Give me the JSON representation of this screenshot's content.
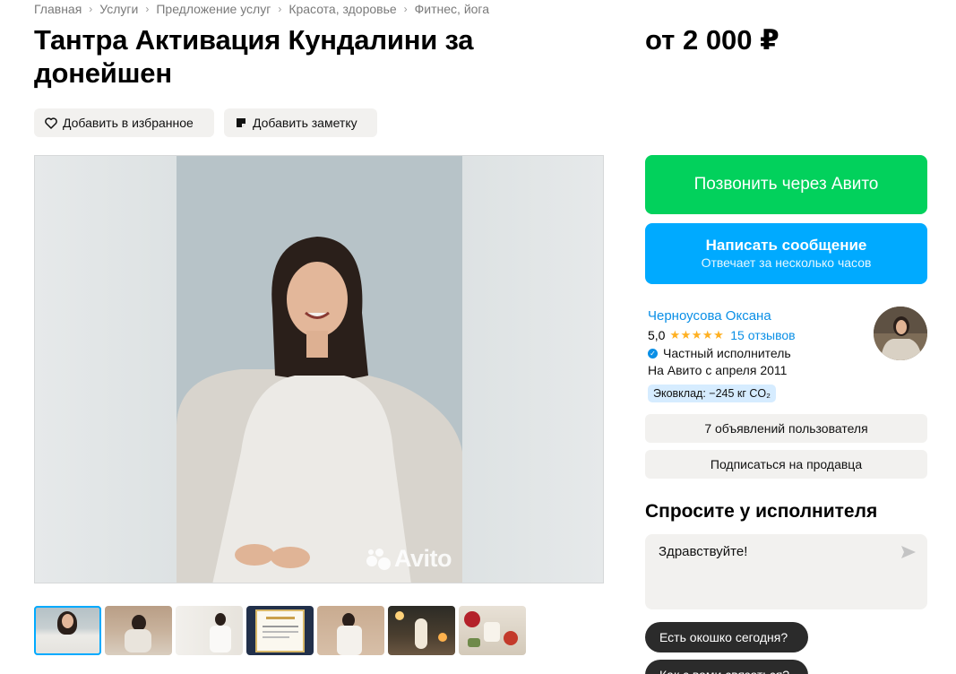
{
  "breadcrumb": [
    "Главная",
    "Услуги",
    "Предложение услуг",
    "Красота, здоровье",
    "Фитнес, йога"
  ],
  "listing": {
    "title": "Тантра Активация Кундалини за донейшен",
    "price": "от 2 000 ₽"
  },
  "actions": {
    "favorite": "Добавить в избранное",
    "note": "Добавить заметку"
  },
  "photo": {
    "watermark": "Avito",
    "thumbnail_count": 7,
    "active_thumbnail": 1
  },
  "contact": {
    "call": "Позвонить через Авито",
    "message": "Написать сообщение",
    "message_sub": "Отвечает за несколько часов"
  },
  "seller": {
    "name": "Черноусова Оксана",
    "rating": "5,0",
    "stars": "★★★★★",
    "reviews": "15 отзывов",
    "type": "Частный исполнитель",
    "since": "На Авито с апреля 2011",
    "eco": "Эковклад: −245 кг CO₂",
    "listings_button": "7 объявлений пользователя",
    "subscribe_button": "Подписаться на продавца"
  },
  "ask": {
    "title": "Спросите у исполнителя",
    "input_value": "Здравствуйте!",
    "chips": [
      "Есть окошко сегодня?",
      "Как с вами связаться?"
    ]
  },
  "colors": {
    "call_green": "#02d15c",
    "message_blue": "#00aaff",
    "link_blue": "#0a8fe6",
    "star_orange": "#ffb021"
  },
  "icons": {
    "breadcrumb_separator": "chevron-right-icon",
    "favorite": "heart-icon",
    "note": "note-icon",
    "verified": "verified-check-icon",
    "send": "send-icon"
  }
}
